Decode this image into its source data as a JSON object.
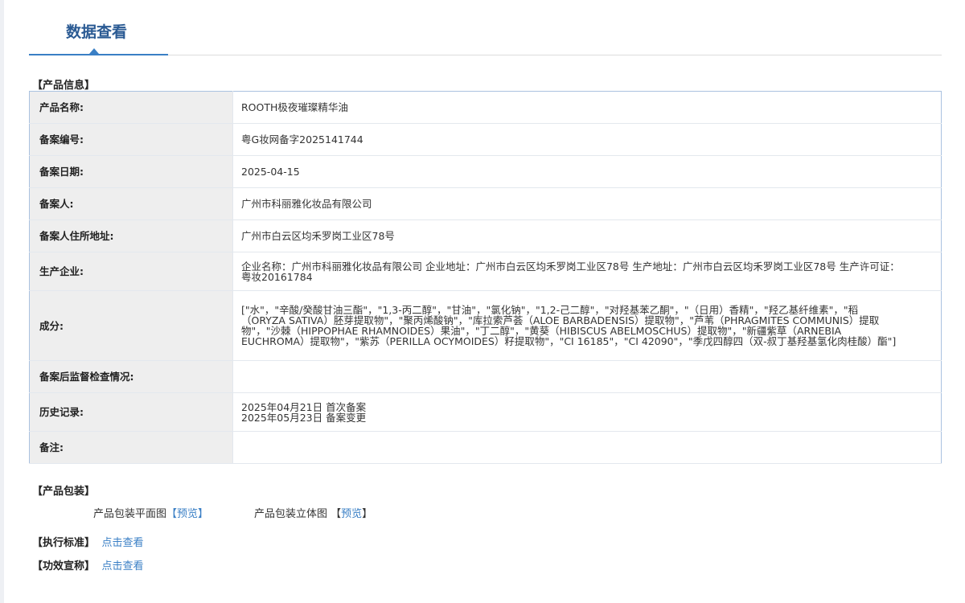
{
  "header": {
    "tab_label": "数据查看"
  },
  "product_info": {
    "section_title": "【产品信息】",
    "rows": [
      {
        "label": "产品名称:",
        "value": "ROOTH极夜璀璨精华油"
      },
      {
        "label": "备案编号:",
        "value": "粤G妆网备字2025141744"
      },
      {
        "label": "备案日期:",
        "value": "2025-04-15"
      },
      {
        "label": "备案人:",
        "value": "广州市科丽雅化妆品有限公司"
      },
      {
        "label": "备案人住所地址:",
        "value": "广州市白云区均禾罗岗工业区78号"
      },
      {
        "label": "生产企业:",
        "value": "企业名称：广州市科丽雅化妆品有限公司 企业地址：广州市白云区均禾罗岗工业区78号 生产地址：广州市白云区均禾罗岗工业区78号 生产许可证：粤妆20161784"
      },
      {
        "label": "成分:",
        "value": "[\"水\"，\"辛酸/癸酸甘油三酯\"，\"1,3-丙二醇\"，\"甘油\"，\"氯化钠\"，\"1,2-己二醇\"，\"对羟基苯乙酮\"，\"（日用）香精\"，\"羟乙基纤维素\"，\"稻（ORYZA SATIVA）胚芽提取物\"，\"聚丙烯酸钠\"，\"库拉索芦荟（ALOE BARBADENSIS）提取物\"，\"芦苇（PHRAGMITES COMMUNIS）提取物\"，\"沙棘（HIPPOPHAE RHAMNOIDES）果油\"，\"丁二醇\"，\"黄葵（HIBISCUS ABELMOSCHUS）提取物\"，\"新疆紫草（ARNEBIA EUCHROMA）提取物\"，\"紫苏（PERILLA OCYMOIDES）籽提取物\"，\"CI 16185\"，\"CI 42090\"，\"季戊四醇四（双-叔丁基羟基氢化肉桂酸）酯\"]"
      },
      {
        "label": "备案后监督检查情况:",
        "value": ""
      },
      {
        "label": "历史记录:",
        "value_lines": [
          "2025年04月21日 首次备案",
          "2025年05月23日 备案变更"
        ]
      },
      {
        "label": "备注:",
        "value": ""
      }
    ]
  },
  "packaging": {
    "section_title": "【产品包装】",
    "flat_label": "产品包装平面图",
    "flat_link": "【预览】",
    "solid_label": "产品包装立体图",
    "solid_link_open": " 【",
    "solid_link": "预览",
    "solid_link_close": "】"
  },
  "standard": {
    "section_title": "【执行标准】",
    "link": "点击查看"
  },
  "efficacy": {
    "section_title": "【功效宣称】",
    "link": "点击查看"
  }
}
